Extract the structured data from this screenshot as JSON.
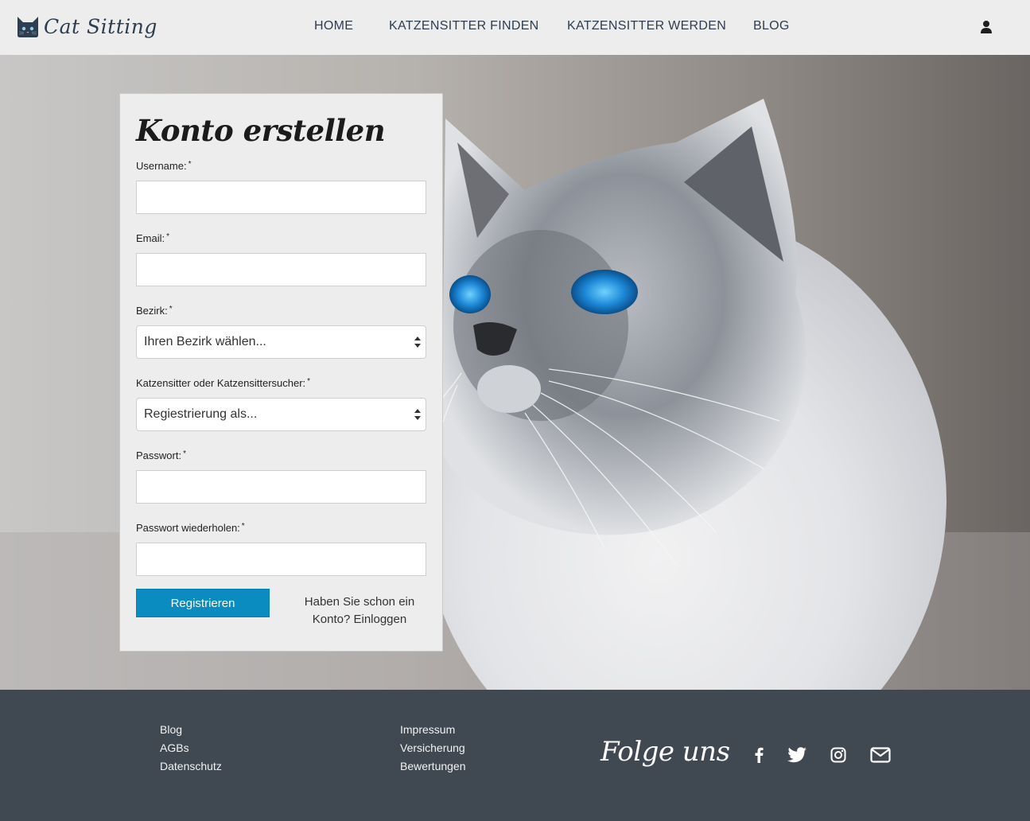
{
  "header": {
    "brand": "Cat Sitting",
    "nav": [
      {
        "label": "HOME"
      },
      {
        "label": "KATZENSITTER FINDEN"
      },
      {
        "label": "KATZENSITTER WERDEN"
      },
      {
        "label": "BLOG"
      }
    ],
    "user_icon": "user-icon"
  },
  "form": {
    "title": "Konto erstellen",
    "fields": {
      "username": {
        "label": "Username:",
        "required": "*",
        "value": ""
      },
      "email": {
        "label": "Email:",
        "required": "*",
        "value": ""
      },
      "bezirk": {
        "label": "Bezirk:",
        "required": "*",
        "selected": "Ihren Bezirk wählen..."
      },
      "rolle": {
        "label": "Katzensitter oder Katzensittersucher:",
        "required": "*",
        "selected": "Regiestrierung als..."
      },
      "passwort": {
        "label": "Passwort:",
        "required": "*",
        "value": ""
      },
      "passwort_repeat": {
        "label": "Passwort wiederholen:",
        "required": "*",
        "value": ""
      }
    },
    "submit_label": "Registrieren",
    "login_text": "Haben Sie schon ein Konto? Einloggen"
  },
  "footer": {
    "col1": [
      "Blog",
      "AGBs",
      "Datenschutz"
    ],
    "col2": [
      "Impressum",
      "Versicherung",
      "Bewertungen"
    ],
    "follow_title": "Folge uns",
    "social_icons": [
      "facebook-icon",
      "twitter-icon",
      "instagram-icon",
      "email-icon"
    ]
  },
  "colors": {
    "header_bg": "#ededed",
    "nav_text": "#2e3d4f",
    "button": "#0b8cc0",
    "footer_bg": "#404852"
  }
}
